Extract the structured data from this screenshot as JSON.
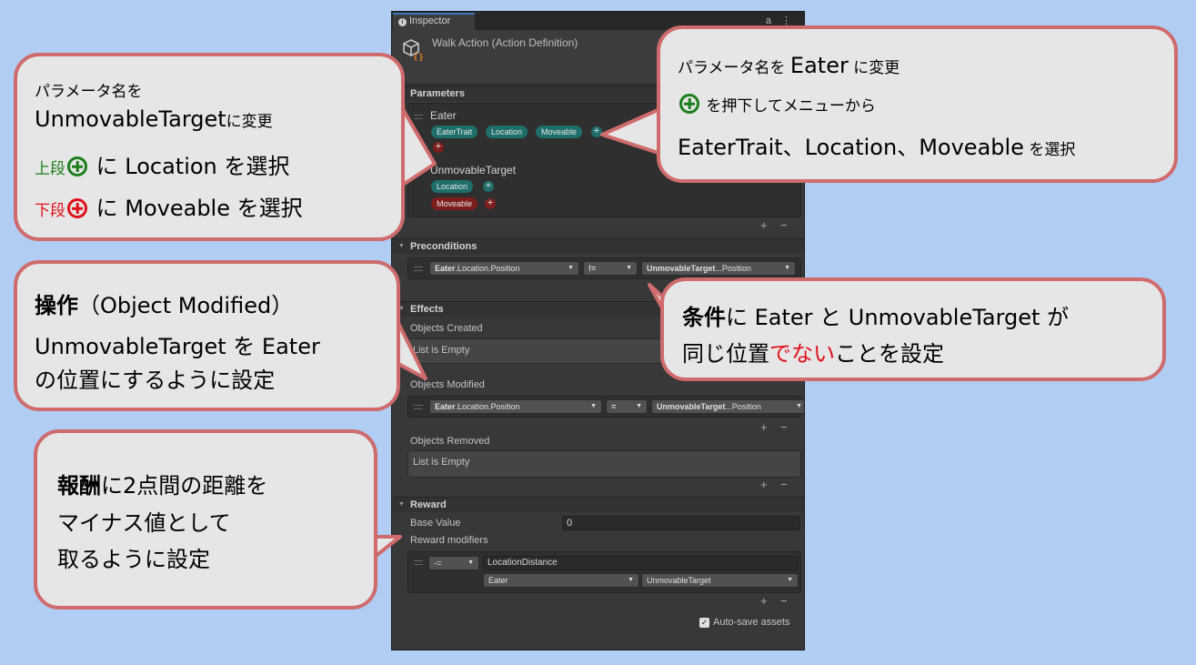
{
  "inspector": {
    "tab_label": "Inspector",
    "tab_tools": "a ⋮",
    "title": "Walk Action (Action Definition)",
    "sections": {
      "parameters": "Parameters",
      "preconditions": "Preconditions",
      "effects": "Effects",
      "reward": "Reward"
    },
    "parameters": [
      {
        "name": "Eater",
        "traits": [
          "EaterTrait",
          "Location",
          "Moveable"
        ]
      },
      {
        "name": "UnmovableTarget",
        "row1": [
          "Location"
        ],
        "row2": [
          "Moveable"
        ]
      }
    ],
    "precondition": {
      "left": {
        "bold": "Eater",
        "rest": ".Location.Position"
      },
      "op": "!=",
      "right": {
        "bold": "UnmovableTarget",
        "rest": "...Position"
      }
    },
    "effects": {
      "objects_created_label": "Objects Created",
      "objects_created_value": "List is Empty",
      "objects_modified_label": "Objects Modified",
      "modified": {
        "left": {
          "bold": "Eater",
          "rest": ".Location.Position"
        },
        "op": "=",
        "right": {
          "bold": "UnmovableTarget",
          "rest": "...Position"
        }
      },
      "objects_removed_label": "Objects Removed",
      "objects_removed_value": "List is Empty"
    },
    "reward": {
      "base_value_label": "Base Value",
      "base_value": "0",
      "modifiers_label": "Reward modifiers",
      "modifier_op": "-=",
      "modifier_name": "LocationDistance",
      "arg1": "Eater",
      "arg2": "UnmovableTarget"
    },
    "auto_save_label": "Auto-save assets",
    "plus": "+",
    "minus": "−"
  },
  "callouts": {
    "left1": {
      "line1": "パラメータ名を",
      "line2a": "UnmovableTarget",
      "line2b": "に変更",
      "line3_prefix": "上段",
      "line3_rest": " に Location を選択",
      "line4_prefix": "下段",
      "line4_rest": " に Moveable を選択"
    },
    "right1": {
      "line1a": "パラメータ名を ",
      "line1b": "Eater",
      "line1c": " に変更",
      "line2": " を押下してメニューから",
      "line3a": "EaterTrait、Location、Moveable",
      "line3b": " を選択"
    },
    "left2": {
      "line1a": "操作",
      "line1b": "（Object Modified）",
      "line2": "UnmovableTarget を Eater",
      "line3": "の位置にするように設定"
    },
    "right2": {
      "line1a": "条件",
      "line1b": "に Eater と UnmovableTarget が",
      "line2a": "同じ位置",
      "line2b": "でない",
      "line2c": "ことを設定"
    },
    "left3": {
      "line1a": "報酬",
      "line1b": "に2点間の距離を",
      "line2": "マイナス値として",
      "line3": "取るように設定"
    }
  },
  "colors": {
    "background": "#b1cdf3",
    "callout_border": "#cf6b6c",
    "callout_fill": "#e6e6e6",
    "teal_pill": "#1e6e6a",
    "red_pill": "#7e1d1d",
    "highlight_red": "#e0101a",
    "highlight_green": "#1b7f1b"
  }
}
